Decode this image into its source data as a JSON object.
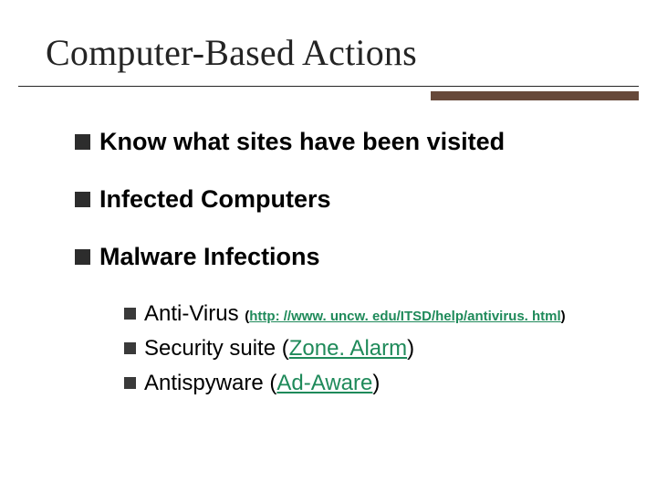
{
  "title": "Computer-Based Actions",
  "bullets": {
    "b1": "Know what sites have been visited",
    "b2": "Infected Computers",
    "b3": "Malware Infections"
  },
  "sub": {
    "s1_lead": "Anti-Virus ",
    "s1_lp": "(",
    "s1_link": "http: //www. uncw. edu/ITSD/help/antivirus. html",
    "s1_rp": ")",
    "s2_lead": "Security suite (",
    "s2_link": "Zone. Alarm",
    "s2_rp": ")",
    "s3_lead": "Antispyware (",
    "s3_link": "Ad-Aware",
    "s3_rp": ")"
  }
}
